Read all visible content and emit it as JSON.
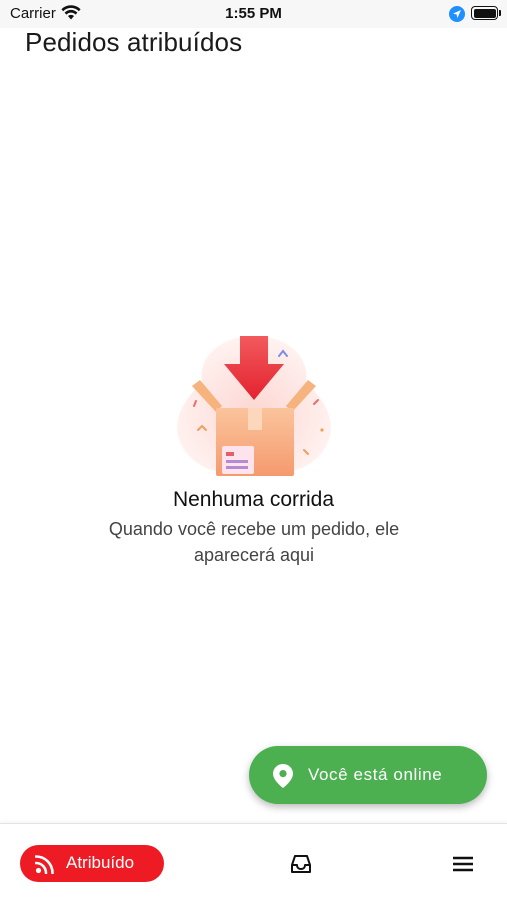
{
  "status_bar": {
    "carrier": "Carrier",
    "time": "1:55 PM",
    "icons": [
      "wifi-icon",
      "location-icon",
      "battery-icon"
    ]
  },
  "page": {
    "title": "Pedidos atribuídos"
  },
  "empty_state": {
    "illustration": "open-box-with-arrow-illustration",
    "title": "Nenhuma corrida",
    "subtitle": "Quando você recebe um pedido, ele aparecerá aqui"
  },
  "online_button": {
    "icon": "location-pin-icon",
    "label": "Você está online",
    "color": "#4caf50"
  },
  "bottom_nav": {
    "assigned": {
      "icon": "rss-feed-icon",
      "label": "Atribuído",
      "color": "#ee1b24",
      "selected": true
    },
    "orders": {
      "icon": "inbox-icon"
    },
    "menu": {
      "icon": "hamburger-menu-icon"
    }
  }
}
